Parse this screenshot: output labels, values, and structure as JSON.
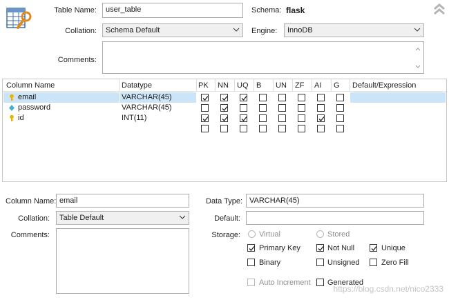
{
  "table": {
    "name_label": "Table Name:",
    "name_value": "user_table",
    "schema_label": "Schema:",
    "schema_value": "flask",
    "collation_label": "Collation:",
    "collation_value": "Schema Default",
    "engine_label": "Engine:",
    "engine_value": "InnoDB",
    "comments_label": "Comments:",
    "icon": "table-edit-icon",
    "collapse_icon": "double-chevron-up-icon"
  },
  "grid": {
    "headers": [
      "Column Name",
      "Datatype",
      "PK",
      "NN",
      "UQ",
      "B",
      "UN",
      "ZF",
      "AI",
      "G",
      "Default/Expression"
    ],
    "rows": [
      {
        "name": "email",
        "datatype": "VARCHAR(45)",
        "icon": "key-icon",
        "flags": [
          true,
          true,
          true,
          false,
          false,
          false,
          false,
          false
        ],
        "selected": true
      },
      {
        "name": "password",
        "datatype": "VARCHAR(45)",
        "icon": "diamond-icon",
        "flags": [
          false,
          true,
          false,
          false,
          false,
          false,
          false,
          false
        ],
        "selected": false
      },
      {
        "name": "id",
        "datatype": "INT(11)",
        "icon": "key-icon",
        "flags": [
          true,
          true,
          true,
          false,
          false,
          false,
          true,
          false
        ],
        "selected": false
      },
      {
        "name": "",
        "datatype": "",
        "icon": "",
        "flags": [
          false,
          false,
          false,
          false,
          false,
          false,
          false,
          false
        ],
        "selected": false
      }
    ]
  },
  "detail": {
    "colname_label": "Column Name:",
    "colname_value": "email",
    "datatype_label": "Data Type:",
    "datatype_value": "VARCHAR(45)",
    "collation_label": "Collation:",
    "collation_value": "Table Default",
    "default_label": "Default:",
    "default_value": "",
    "comments_label": "Comments:",
    "storage_label": "Storage:",
    "virtual_label": "Virtual",
    "stored_label": "Stored",
    "primary_key_label": "Primary Key",
    "not_null_label": "Not Null",
    "unique_label": "Unique",
    "binary_label": "Binary",
    "unsigned_label": "Unsigned",
    "zero_fill_label": "Zero Fill",
    "auto_increment_label": "Auto Increment",
    "generated_label": "Generated"
  },
  "watermark": "https://blog.csdn.net/nico2333",
  "colors": {
    "selection": "#cce4f7",
    "key": "#e8b400",
    "diamond": "#46b3c8"
  }
}
